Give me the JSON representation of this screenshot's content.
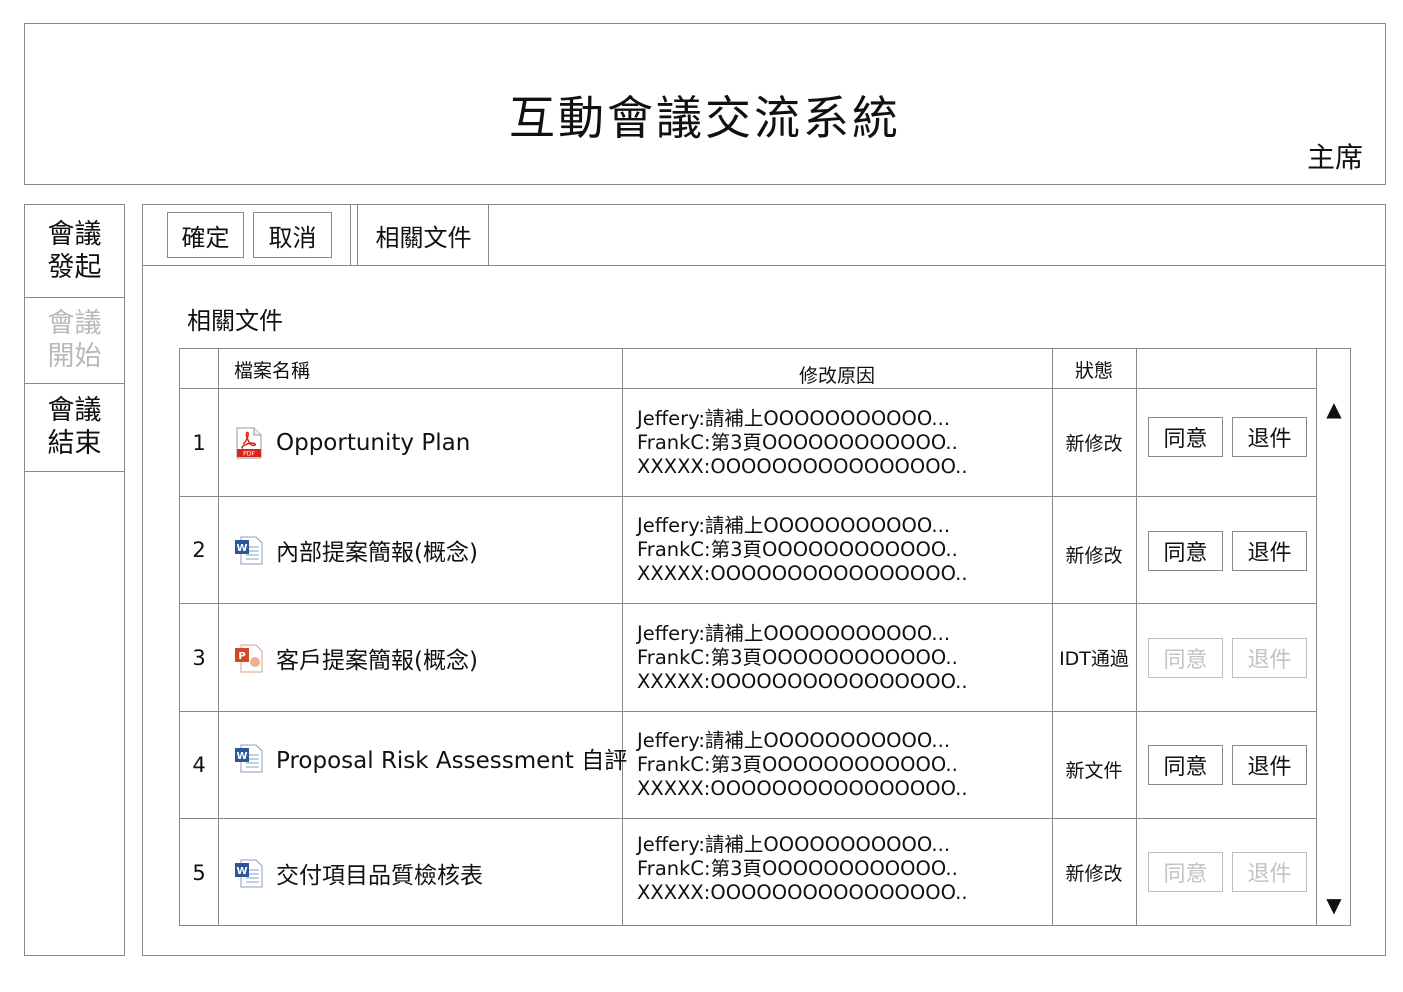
{
  "header": {
    "title": "互動會議交流系統",
    "role": "主席"
  },
  "sidebar": {
    "items": [
      {
        "label": "會議發起",
        "enabled": true
      },
      {
        "label": "會議開始",
        "enabled": false
      },
      {
        "label": "會議結束",
        "enabled": true
      }
    ]
  },
  "toolbar": {
    "confirm_label": "確定",
    "cancel_label": "取消",
    "tab_label": "相關文件"
  },
  "section": {
    "title": "相關文件"
  },
  "table": {
    "headers": {
      "file_name": "檔案名稱",
      "reason": "修改原因",
      "status": "狀態"
    },
    "rows": [
      {
        "index": "1",
        "file_type": "pdf-icon",
        "file_name": "Opportunity Plan",
        "reasons": [
          "Jeffery:請補上OOOOOOOOOOO...",
          "FrankC:第3頁OOOOOOOOOOOO..",
          "XXXXX:OOOOOOOOOOOOOOOO.."
        ],
        "status": "新修改",
        "agree_label": "同意",
        "return_label": "退件",
        "actions_enabled": true
      },
      {
        "index": "2",
        "file_type": "word-icon",
        "file_name": "內部提案簡報(概念)",
        "reasons": [
          "Jeffery:請補上OOOOOOOOOOO...",
          "FrankC:第3頁OOOOOOOOOOOO..",
          "XXXXX:OOOOOOOOOOOOOOOO.."
        ],
        "status": "新修改",
        "agree_label": "同意",
        "return_label": "退件",
        "actions_enabled": true
      },
      {
        "index": "3",
        "file_type": "powerpoint-icon",
        "file_name": "客戶提案簡報(概念)",
        "reasons": [
          "Jeffery:請補上OOOOOOOOOOO...",
          "FrankC:第3頁OOOOOOOOOOOO..",
          "XXXXX:OOOOOOOOOOOOOOOO.."
        ],
        "status": "IDT通過",
        "agree_label": "同意",
        "return_label": "退件",
        "actions_enabled": false
      },
      {
        "index": "4",
        "file_type": "word-icon",
        "file_name": "Proposal Risk Assessment 自評",
        "reasons": [
          "Jeffery:請補上OOOOOOOOOOO...",
          "FrankC:第3頁OOOOOOOOOOOO..",
          "XXXXX:OOOOOOOOOOOOOOOO.."
        ],
        "status": "新文件",
        "agree_label": "同意",
        "return_label": "退件",
        "actions_enabled": true
      },
      {
        "index": "5",
        "file_type": "word-icon",
        "file_name": "交付項目品質檢核表",
        "reasons": [
          "Jeffery:請補上OOOOOOOOOOO...",
          "FrankC:第3頁OOOOOOOOOOOO..",
          "XXXXX:OOOOOOOOOOOOOOOO.."
        ],
        "status": "新修改",
        "agree_label": "同意",
        "return_label": "退件",
        "actions_enabled": false
      }
    ],
    "scroll_up_icon": "triangle-up-icon",
    "scroll_down_icon": "triangle-down-icon"
  },
  "colors": {
    "border": "#8a8a8a",
    "disabled_text": "#c3c3c3",
    "pdf_red": "#d9261c",
    "word_blue": "#2b5797",
    "ppt_orange": "#d24726"
  }
}
